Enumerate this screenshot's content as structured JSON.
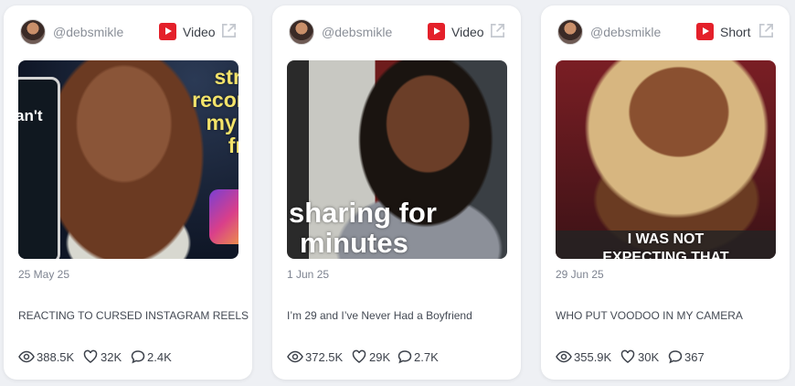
{
  "cards": [
    {
      "handle": "@debsmikle",
      "platform_icon": "youtube-icon",
      "post_type": "Video",
      "thumbnail_text": [
        "stron",
        "reconsi",
        "my us",
        "free"
      ],
      "phone_text": "an't",
      "date": "25 May 25",
      "title": "REACTING TO CURSED INSTAGRAM REELS",
      "views": "388.5K",
      "likes": "32K",
      "comments": "2.4K"
    },
    {
      "handle": "@debsmikle",
      "platform_icon": "youtube-icon",
      "post_type": "Video",
      "thumbnail_text": [
        "sharing for",
        "minutes"
      ],
      "date": "1 Jun 25",
      "title": "I’m 29 and I’ve Never Had a Boyfriend",
      "views": "372.5K",
      "likes": "29K",
      "comments": "2.7K"
    },
    {
      "handle": "@debsmikle",
      "platform_icon": "youtube-icon",
      "post_type": "Short",
      "thumbnail_text": [
        "I WAS NOT",
        "EXPECTING THAT"
      ],
      "date": "29 Jun 25",
      "title": "WHO PUT VOODOO IN MY CAMERA",
      "views": "355.9K",
      "likes": "30K",
      "comments": "367"
    }
  ],
  "colors": {
    "background": "#eef0f4",
    "card": "#ffffff",
    "youtube_red": "#e4202a",
    "muted_text": "#8a8f98"
  }
}
